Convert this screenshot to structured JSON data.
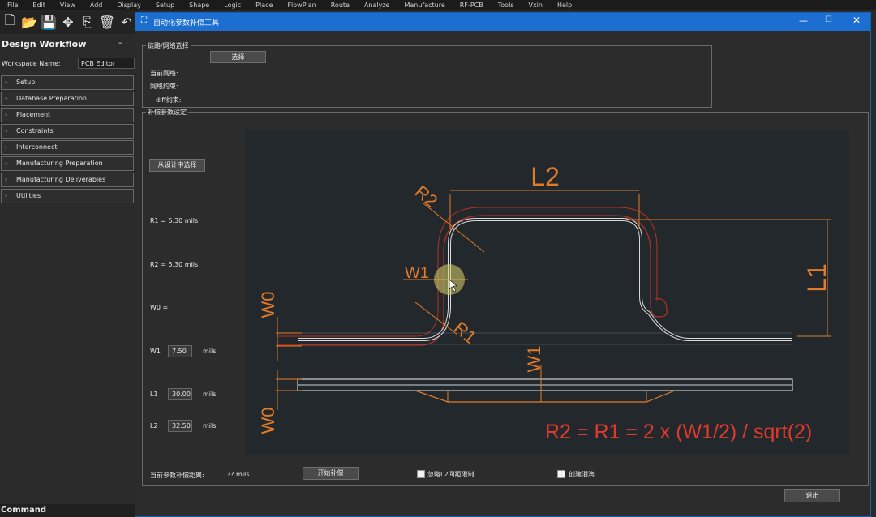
{
  "menubar": [
    "File",
    "Edit",
    "View",
    "Add",
    "Display",
    "Setup",
    "Shape",
    "Logic",
    "Place",
    "FlowPlan",
    "Route",
    "Analyze",
    "Manufacture",
    "RF-PCB",
    "Tools",
    "Vxin",
    "Help"
  ],
  "workflow": {
    "title": "Design Workflow",
    "minimize": "–",
    "workspace_label": "Workspace Name:",
    "workspace_value": "PCB Editor",
    "items": [
      "Setup",
      "Database Preparation",
      "Placement",
      "Constraints",
      "Interconnect",
      "Manufacturing Preparation",
      "Manufacturing Deliverables",
      "Utilities"
    ]
  },
  "command_label": "Command",
  "dialog": {
    "title": "自动化参数补偿工具",
    "net_group": {
      "legend": "链路/网络选择",
      "select_button": "选择",
      "current_net_label": "当前网络:",
      "net_constraint_label": "网络约束:",
      "diff_constraint_label": "diff约束:"
    },
    "param_group": {
      "legend": "补偿参数设定",
      "from_design_button": "从设计中选择",
      "r1_text": "R1 = 5.30 mils",
      "r2_text": "R2 = 5.30 mils",
      "w0_text": "W0 =",
      "w1": {
        "label": "W1",
        "value": "7.50",
        "unit": "mils"
      },
      "l1": {
        "label": "L1",
        "value": "30.00",
        "unit": "mils"
      },
      "l2": {
        "label": "L2",
        "value": "32.50",
        "unit": "mils"
      },
      "current_comp_label": "当前参数补偿距离:",
      "current_comp_value": "?? mils",
      "start_button": "开始补偿",
      "ignore_l2_label": "忽略L2间距限制",
      "create_teardrop_label": "创建泪滴"
    },
    "exit_button": "退出",
    "diagram_labels": {
      "l2": "L2",
      "l1": "L1",
      "r2": "R2",
      "r1": "R1",
      "w1_top": "W1",
      "w0_top": "W0",
      "w1_bottom": "W1",
      "w0_bottom": "W0",
      "formula": "R2 = R1 = 2 x (W1/2) / sqrt(2)"
    }
  },
  "colors": {
    "titlebar": "#1c6fd1",
    "dimension": "#e07b2a",
    "formula": "#e03a2f"
  }
}
